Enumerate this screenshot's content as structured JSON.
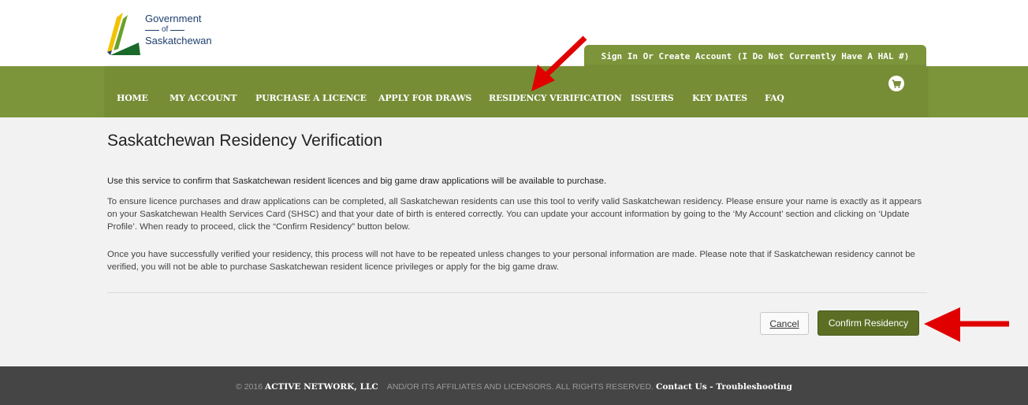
{
  "header": {
    "logo": {
      "line1": "Government",
      "line2": "of",
      "line3": "Saskatchewan"
    },
    "signin_tab": "Sign In Or Create Account (I Do Not Currently Have A HAL #)"
  },
  "nav": {
    "items": [
      {
        "label": "HOME"
      },
      {
        "label": "MY ACCOUNT"
      },
      {
        "label": "PURCHASE A LICENCE"
      },
      {
        "label": "APPLY FOR DRAWS"
      },
      {
        "label": "RESIDENCY VERIFICATION"
      },
      {
        "label": "ISSUERS"
      },
      {
        "label": "KEY DATES"
      },
      {
        "label": "FAQ"
      }
    ],
    "cart_icon": "cart-icon"
  },
  "main": {
    "title": "Saskatchewan Residency Verification",
    "intro": "Use this service to confirm that Saskatchewan resident licences and big game draw applications will be available to purchase.",
    "para1": "To ensure licence purchases and draw applications can be completed, all Saskatchewan residents can use this tool to verify valid Saskatchewan residency. Please ensure your name is exactly as it appears on your Saskatchewan Health Services Card (SHSC) and that your date of birth is entered correctly. You can update your account information by going to the ‘My Account’ section and clicking on ‘Update Profile’. When ready to proceed, click the “Confirm Residency” button below.",
    "para2": "Once you have successfully verified your residency, this process will not have to be repeated unless changes to your personal information are made. Please note that if Saskatchewan residency cannot be verified, you will not be able to purchase Saskatchewan resident licence privileges or apply for the big game draw.",
    "cancel_label": "Cancel",
    "confirm_label": "Confirm Residency"
  },
  "footer": {
    "copyright": "© 2016",
    "company": "ACTIVE NETWORK, LLC",
    "rights": "AND/OR ITS AFFILIATES AND LICENSORS. ALL RIGHTS RESERVED.",
    "contact": "Contact Us",
    "separator": " - ",
    "troubleshooting": "Troubleshooting"
  },
  "colors": {
    "nav_green": "#7c943a",
    "button_green": "#5b6e24",
    "footer_gray": "#454545",
    "annotation_red": "#e00000"
  }
}
